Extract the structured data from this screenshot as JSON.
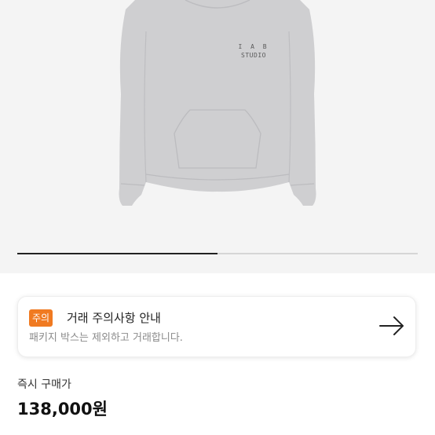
{
  "product": {
    "image_print_line1": "I A B",
    "image_print_line2": "STUDIO",
    "image_subject": "hoodie-image",
    "garment_color": "#cfcfd1",
    "print_color": "#5a5a5a"
  },
  "gallery": {
    "slide_progress": 0.5,
    "track_color": "#d6d6d6",
    "fill_color": "#222222",
    "background_color": "#f4f4f4"
  },
  "notice": {
    "badge": "주의",
    "badge_color": "#f07a21",
    "title": "거래 주의사항 안내",
    "description": "패키지 박스는 제외하고 거래합니다.",
    "arrow_icon": "arrow-right-icon"
  },
  "price": {
    "label": "즉시 구매가",
    "value": "138,000원"
  }
}
